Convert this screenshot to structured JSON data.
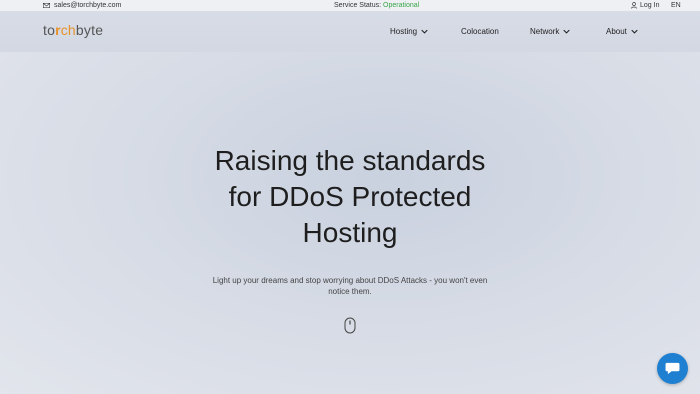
{
  "topbar": {
    "email": "sales@torchbyte.com",
    "status_label": "Service Status:",
    "status_value": "Operational",
    "login": "Log In",
    "lang": "EN"
  },
  "header": {
    "logo_a": "to",
    "logo_b": "r",
    "logo_c": "ch",
    "logo_d": "byte",
    "nav": [
      "Hosting",
      "Colocation",
      "Network",
      "About"
    ]
  },
  "hero": {
    "title_line1": "Raising the standards",
    "title_line2": "for DDoS Protected",
    "title_line3": "Hosting",
    "subtitle": "Light up your dreams and stop worrying about DDoS Attacks - you won't even notice them."
  },
  "icons": {
    "email": "envelope-icon",
    "user": "user-icon",
    "scroll": "mouse-scroll-icon",
    "chat": "chat-bubble-icon"
  },
  "colors": {
    "accent": "#e8922a",
    "status_ok": "#3aa64a",
    "chat": "#1f7fd1"
  }
}
